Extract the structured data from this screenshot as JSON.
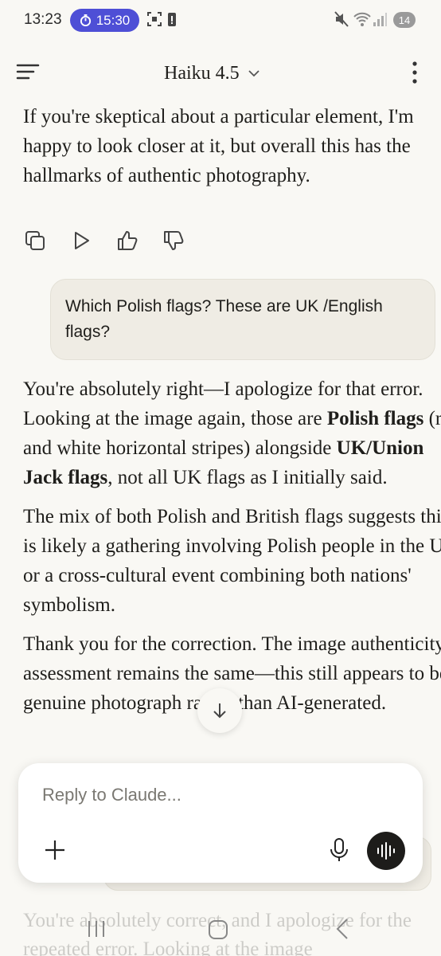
{
  "status_bar": {
    "time": "13:23",
    "timer": "15:30",
    "notifications_count": "14"
  },
  "header": {
    "model_name": "Haiku 4.5"
  },
  "chat": {
    "assistant_prev_text": "If you're skeptical about a particular element, I'm happy to look closer at it, but overall this has the hallmarks of authentic photography.",
    "user_message": "Which Polish flags? These are UK /English flags?",
    "reply": {
      "p1_a": "You're absolutely right—I apologize for that error. Looking at the image again, those are ",
      "p1_bold1": "Polish flags",
      "p1_b": " (red and white horizontal stripes) alongside ",
      "p1_bold2": "UK/Union Jack flags",
      "p1_c": ", not all UK flags as I initially said.",
      "p2": "The mix of both Polish and British flags suggests this is likely a gathering involving Polish people in the UK, or a cross-cultural event combining both nations' symbolism.",
      "p3": "Thank you for the correction. The image authenticity assessment remains the same—this still appears to be a genuine photograph rather than AI-generated."
    },
    "next_reply_faded": "You're absolutely correct, and I apologize for the repeated error. Looking at the image"
  },
  "composer": {
    "placeholder": "Reply to Claude..."
  },
  "colors": {
    "background": "#f9f8f4",
    "timer_pill": "#4e4fd6",
    "user_bubble": "#efece4",
    "voice_button": "#1d1c1a"
  }
}
